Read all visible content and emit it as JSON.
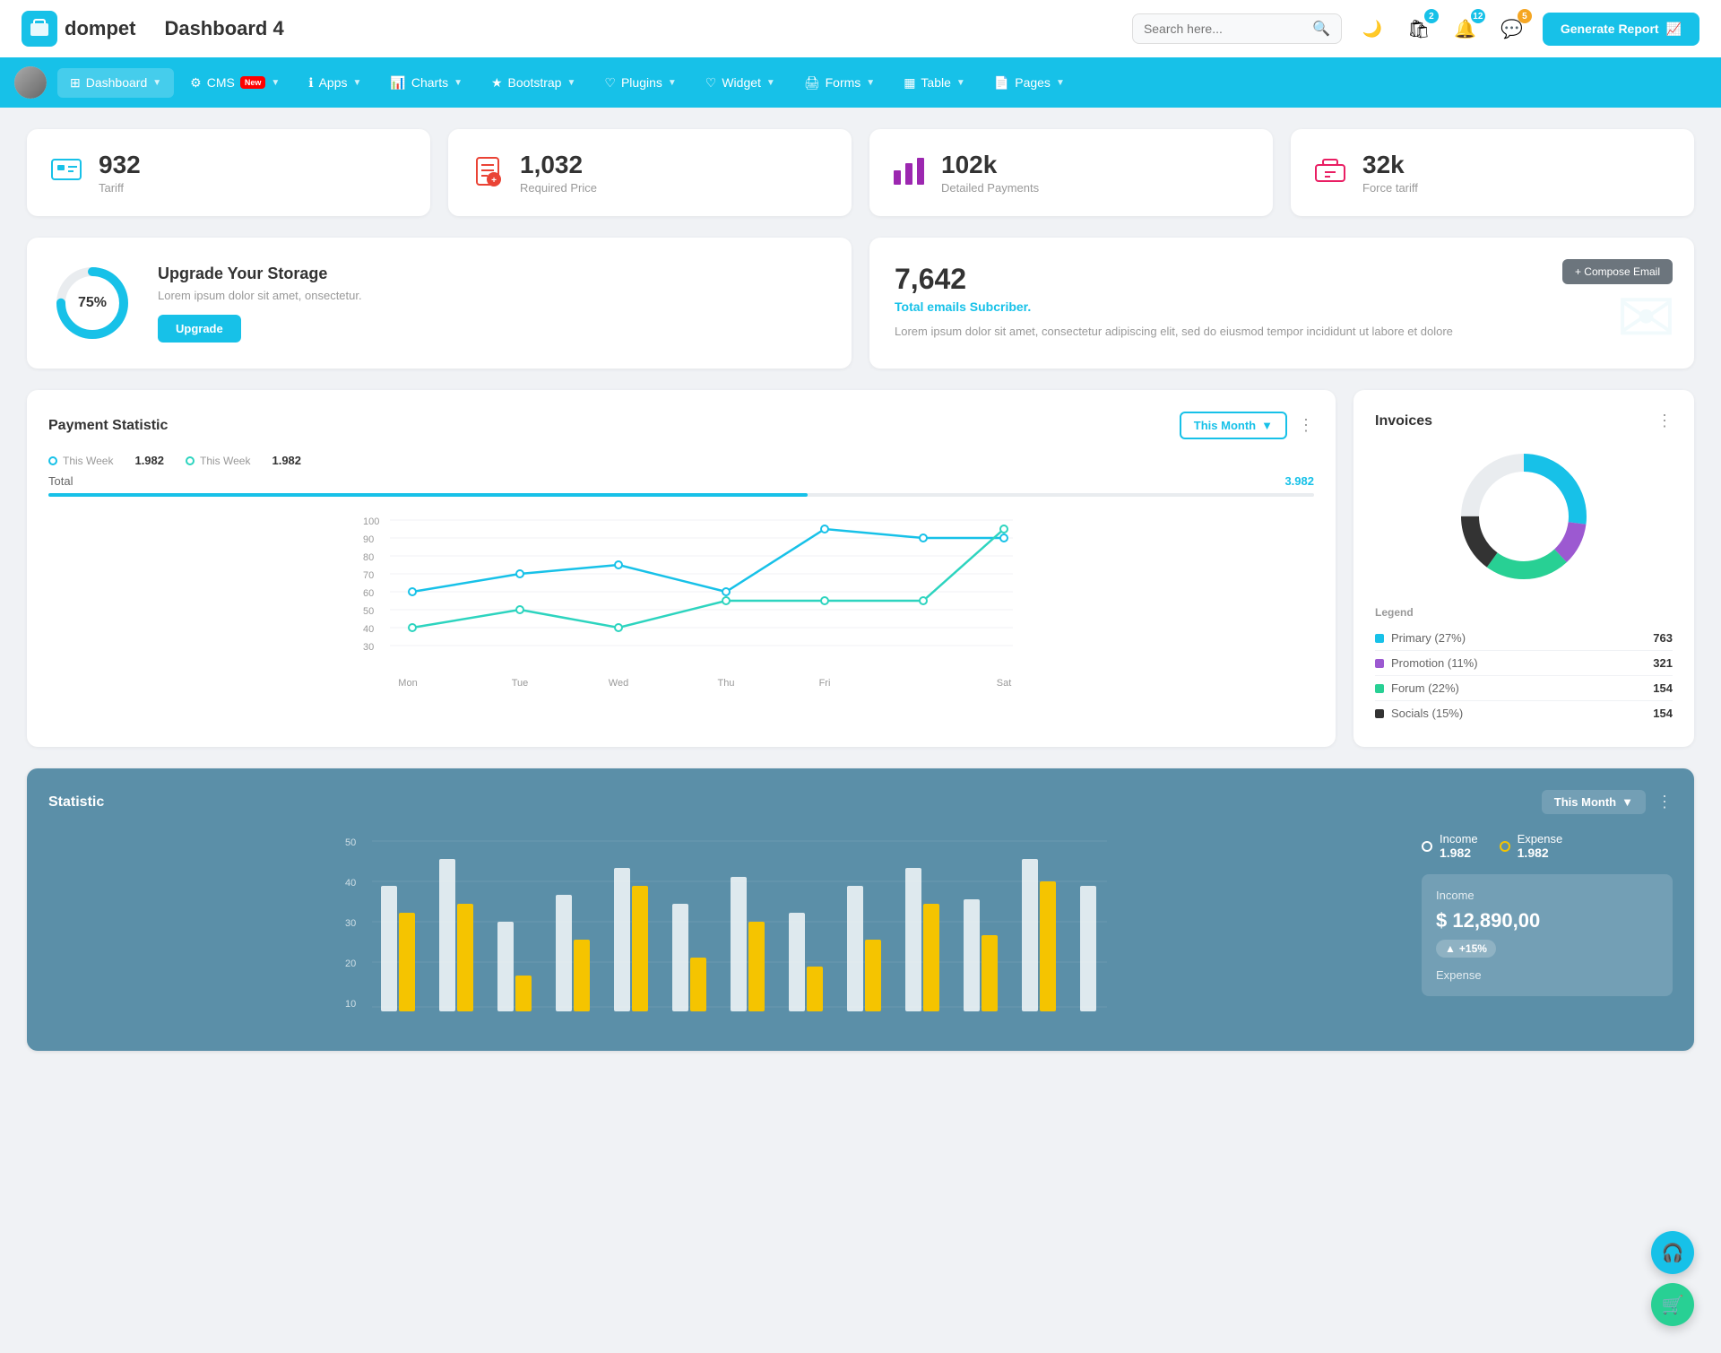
{
  "app": {
    "logo_emoji": "💼",
    "logo_text": "dompet",
    "title": "Dashboard 4",
    "generate_btn": "Generate Report"
  },
  "topbar": {
    "search_placeholder": "Search here...",
    "badge_cart": "2",
    "badge_bell": "12",
    "badge_chat": "5"
  },
  "navbar": {
    "items": [
      {
        "id": "dashboard",
        "label": "Dashboard",
        "icon": "⊞",
        "active": true,
        "badge": null
      },
      {
        "id": "cms",
        "label": "CMS",
        "icon": "⚙",
        "active": false,
        "badge": "New"
      },
      {
        "id": "apps",
        "label": "Apps",
        "icon": "ℹ",
        "active": false,
        "badge": null
      },
      {
        "id": "charts",
        "label": "Charts",
        "icon": "📊",
        "active": false,
        "badge": null
      },
      {
        "id": "bootstrap",
        "label": "Bootstrap",
        "icon": "★",
        "active": false,
        "badge": null
      },
      {
        "id": "plugins",
        "label": "Plugins",
        "icon": "♡",
        "active": false,
        "badge": null
      },
      {
        "id": "widget",
        "label": "Widget",
        "icon": "♡",
        "active": false,
        "badge": null
      },
      {
        "id": "forms",
        "label": "Forms",
        "icon": "🖨",
        "active": false,
        "badge": null
      },
      {
        "id": "table",
        "label": "Table",
        "icon": "▦",
        "active": false,
        "badge": null
      },
      {
        "id": "pages",
        "label": "Pages",
        "icon": "📄",
        "active": false,
        "badge": null
      }
    ]
  },
  "stat_cards": [
    {
      "id": "tariff",
      "value": "932",
      "label": "Tariff",
      "icon": "💼",
      "color": "#17c1e8"
    },
    {
      "id": "required_price",
      "value": "1,032",
      "label": "Required Price",
      "icon": "📋",
      "color": "#ea4335"
    },
    {
      "id": "detailed_payments",
      "value": "102k",
      "label": "Detailed Payments",
      "icon": "📊",
      "color": "#9c27b0"
    },
    {
      "id": "force_tariff",
      "value": "32k",
      "label": "Force tariff",
      "icon": "💼",
      "color": "#e91e63"
    }
  ],
  "storage": {
    "percent": 75,
    "title": "Upgrade Your Storage",
    "description": "Lorem ipsum dolor sit amet, onsectetur.",
    "button": "Upgrade"
  },
  "email": {
    "count": "7,642",
    "subtitle": "Total emails Subcriber.",
    "description": "Lorem ipsum dolor sit amet, consectetur adipiscing elit, sed do eiusmod tempor incididunt ut labore et dolore",
    "compose_btn": "+ Compose Email"
  },
  "payment": {
    "title": "Payment Statistic",
    "filter": "This Month",
    "legend1_label": "This Week",
    "legend1_val": "1.982",
    "legend2_label": "This Week",
    "legend2_val": "1.982",
    "total_label": "Total",
    "total_val": "3.982",
    "days": [
      "Mon",
      "Tue",
      "Wed",
      "Thu",
      "Fri",
      "Sat"
    ],
    "y_labels": [
      "100",
      "90",
      "80",
      "70",
      "60",
      "50",
      "40",
      "30"
    ]
  },
  "invoices": {
    "title": "Invoices",
    "legend_title": "Legend",
    "items": [
      {
        "label": "Primary (27%)",
        "color": "#17c1e8",
        "value": "763"
      },
      {
        "label": "Promotion (11%)",
        "color": "#9c59d1",
        "value": "321"
      },
      {
        "label": "Forum (22%)",
        "color": "#28d094",
        "value": "154"
      },
      {
        "label": "Socials (15%)",
        "color": "#333",
        "value": "154"
      }
    ]
  },
  "statistic": {
    "title": "Statistic",
    "filter": "This Month",
    "income_label": "Income",
    "income_val": "1.982",
    "expense_label": "Expense",
    "expense_val": "1.982",
    "income_amount": "$ 12,890,00",
    "income_change": "+15%",
    "expense_section": "Expense",
    "y_labels": [
      "50",
      "40",
      "30",
      "20",
      "10"
    ]
  },
  "month_filter": "Month"
}
